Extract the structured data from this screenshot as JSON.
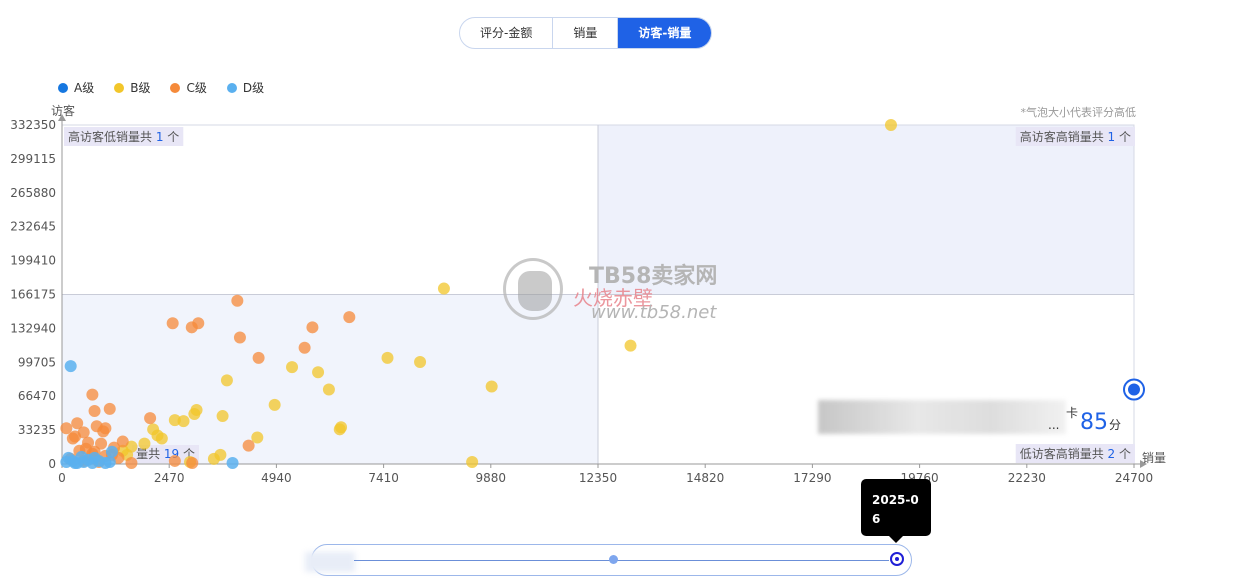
{
  "tabs": [
    {
      "label": "评分-金额",
      "active": false
    },
    {
      "label": "销量",
      "active": false
    },
    {
      "label": "访客-销量",
      "active": true
    }
  ],
  "legend": [
    {
      "label": "A级",
      "color": "#1677e0"
    },
    {
      "label": "B级",
      "color": "#f2c62a"
    },
    {
      "label": "C级",
      "color": "#f58a3a"
    },
    {
      "label": "D级",
      "color": "#5ab0ef"
    }
  ],
  "bubble_note": "*气泡大小代表评分高低",
  "quadrant_labels": {
    "top_left": {
      "text": "高访客低销量共",
      "count": "1",
      "unit": " 个"
    },
    "top_right": {
      "text": "高访客高销量共",
      "count": "1",
      "unit": " 个"
    },
    "bottom_left": {
      "text": "量共",
      "count": "19",
      "unit": " 个"
    },
    "bottom_right": {
      "text": "低访客高销量共",
      "count": "2",
      "unit": " 个"
    }
  },
  "score_card": {
    "suffix": "卡",
    "ellipsis": "...",
    "score": "85",
    "unit": "分"
  },
  "tooltip": {
    "text": "2025-06"
  },
  "watermark": {
    "line1": "TB58卖家网",
    "line2": "火烧赤壁",
    "line3": "www.tb58.net"
  },
  "chart_data": {
    "type": "scatter",
    "xlabel": "销量",
    "ylabel": "访客",
    "xlim": [
      0,
      24700
    ],
    "ylim": [
      0,
      332350
    ],
    "x_ticks": [
      "0",
      "2470",
      "4940",
      "7410",
      "9880",
      "12350",
      "14820",
      "17290",
      "19760",
      "22230",
      "24700"
    ],
    "y_ticks": [
      "0",
      "33235",
      "66470",
      "99705",
      "132940",
      "166175",
      "199410",
      "232645",
      "265880",
      "299115",
      "332350"
    ],
    "quadrant_split": {
      "x": 12350,
      "y": 166175
    },
    "series": [
      {
        "name": "A级",
        "points": [
          [
            24700,
            73000
          ]
        ]
      },
      {
        "name": "B级",
        "points": [
          [
            19100,
            332350
          ],
          [
            8800,
            172000
          ],
          [
            13100,
            116000
          ],
          [
            7500,
            104000
          ],
          [
            8250,
            100000
          ],
          [
            9900,
            76000
          ],
          [
            5900,
            90000
          ],
          [
            6150,
            73000
          ],
          [
            5300,
            95000
          ],
          [
            4900,
            58000
          ],
          [
            6400,
            34000
          ],
          [
            6430,
            36000
          ],
          [
            3800,
            82000
          ],
          [
            3700,
            47000
          ],
          [
            3050,
            49000
          ],
          [
            3100,
            53000
          ],
          [
            2600,
            43000
          ],
          [
            2800,
            42000
          ],
          [
            2100,
            34000
          ],
          [
            2300,
            25000
          ],
          [
            2200,
            28000
          ],
          [
            1900,
            20000
          ],
          [
            1600,
            17000
          ],
          [
            1400,
            13000
          ],
          [
            4500,
            26000
          ],
          [
            3650,
            9000
          ],
          [
            3500,
            5000
          ],
          [
            2950,
            2000
          ],
          [
            1500,
            9000
          ],
          [
            9450,
            2000
          ]
        ]
      },
      {
        "name": "C级",
        "points": [
          [
            4040,
            160000
          ],
          [
            3140,
            138000
          ],
          [
            2550,
            138000
          ],
          [
            2990,
            134000
          ],
          [
            5770,
            134000
          ],
          [
            6620,
            144000
          ],
          [
            4100,
            124000
          ],
          [
            5590,
            114000
          ],
          [
            4530,
            104000
          ],
          [
            700,
            68000
          ],
          [
            350,
            40000
          ],
          [
            750,
            52000
          ],
          [
            1100,
            54000
          ],
          [
            1400,
            22000
          ],
          [
            2030,
            45000
          ],
          [
            800,
            37000
          ],
          [
            950,
            32000
          ],
          [
            1000,
            35000
          ],
          [
            500,
            31000
          ],
          [
            300,
            27000
          ],
          [
            600,
            21000
          ],
          [
            900,
            20000
          ],
          [
            1200,
            16000
          ],
          [
            400,
            13000
          ],
          [
            700,
            10000
          ],
          [
            1000,
            8000
          ],
          [
            1300,
            6000
          ],
          [
            200,
            5000
          ],
          [
            500,
            3000
          ],
          [
            850,
            2000
          ],
          [
            1600,
            1000
          ],
          [
            4300,
            18000
          ],
          [
            2600,
            3000
          ],
          [
            3000,
            1000
          ],
          [
            100,
            35000
          ],
          [
            250,
            25000
          ],
          [
            550,
            15000
          ],
          [
            750,
            12000
          ],
          [
            1150,
            9000
          ]
        ]
      },
      {
        "name": "D级",
        "points": [
          [
            200,
            96000
          ],
          [
            100,
            2000
          ],
          [
            300,
            1000
          ],
          [
            500,
            2000
          ],
          [
            700,
            1000
          ],
          [
            1100,
            2000
          ],
          [
            1000,
            1000
          ],
          [
            250,
            3000
          ],
          [
            600,
            4000
          ],
          [
            850,
            3000
          ],
          [
            1150,
            12000
          ],
          [
            3930,
            1000
          ],
          [
            150,
            6000
          ],
          [
            450,
            7000
          ],
          [
            750,
            6000
          ],
          [
            350,
            1000
          ]
        ]
      }
    ]
  }
}
